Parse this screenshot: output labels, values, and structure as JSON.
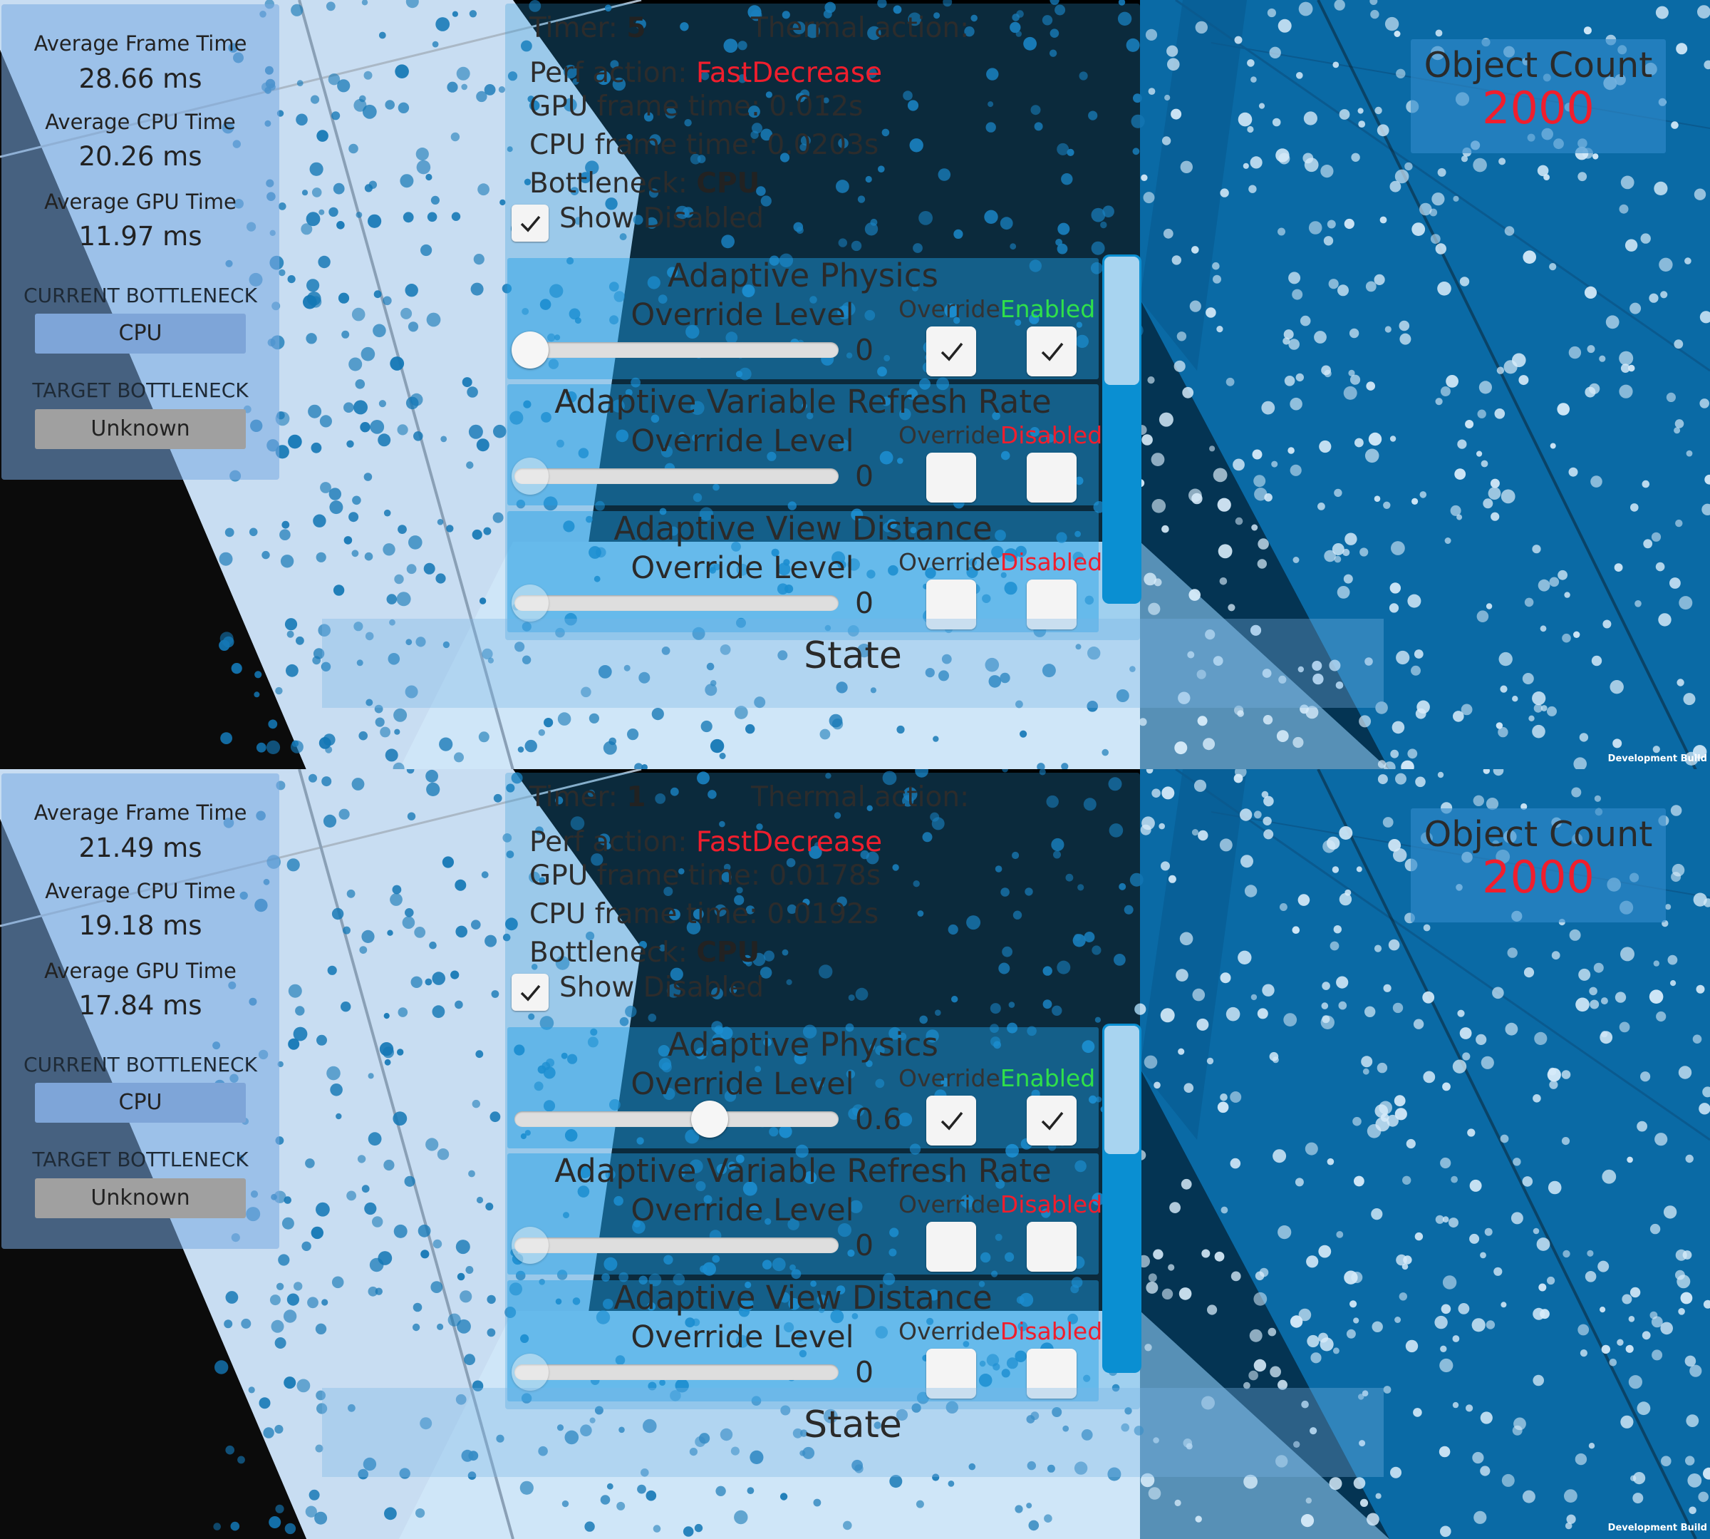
{
  "screens": [
    {
      "stats": {
        "avg_frame_label": "Average Frame Time",
        "avg_frame_value": "28.66 ms",
        "avg_cpu_label": "Average CPU Time",
        "avg_cpu_value": "20.26 ms",
        "avg_gpu_label": "Average GPU Time",
        "avg_gpu_value": "11.97 ms",
        "current_bottleneck_label": "CURRENT BOTTLENECK",
        "current_bottleneck_value": "CPU",
        "target_bottleneck_label": "TARGET BOTTLENECK",
        "target_bottleneck_value": "Unknown"
      },
      "object_count": {
        "title": "Object Count",
        "value": "2000"
      },
      "panel": {
        "timer_label": "Timer:",
        "timer_value": "5",
        "thermal_label": "Thermal action:",
        "perf_action_label": "Perf action:",
        "perf_action_value": "FastDecrease",
        "gpu_frame_time": "GPU frame time: 0.012s",
        "cpu_frame_time": "CPU frame time: 0.0203s",
        "bottleneck_label": "Bottleneck:",
        "bottleneck_value": "CPU",
        "show_disabled_label": "Show Disabled",
        "show_disabled_checked": true,
        "sections": [
          {
            "title": "Adaptive Physics",
            "override_level_label": "Override Level",
            "override_label": "Override",
            "status": "Enabled",
            "status_color": "#2fe04a",
            "level": 0,
            "level_text": "0",
            "override_checked": true,
            "enabled_checked": true,
            "slider_enabled": true
          },
          {
            "title": "Adaptive Variable Refresh Rate",
            "override_level_label": "Override Level",
            "override_label": "Override",
            "status": "Disabled",
            "status_color": "#f01e2d",
            "level": 0,
            "level_text": "0",
            "override_checked": false,
            "enabled_checked": false,
            "slider_enabled": false
          },
          {
            "title": "Adaptive View Distance",
            "override_level_label": "Override Level",
            "override_label": "Override",
            "status": "Disabled",
            "status_color": "#f01e2d",
            "level": 0,
            "level_text": "0",
            "override_checked": false,
            "enabled_checked": false,
            "slider_enabled": false
          }
        ]
      },
      "state_label": "State",
      "dev_build": "Development Build"
    },
    {
      "stats": {
        "avg_frame_label": "Average Frame Time",
        "avg_frame_value": "21.49 ms",
        "avg_cpu_label": "Average CPU Time",
        "avg_cpu_value": "19.18 ms",
        "avg_gpu_label": "Average GPU Time",
        "avg_gpu_value": "17.84 ms",
        "current_bottleneck_label": "CURRENT BOTTLENECK",
        "current_bottleneck_value": "CPU",
        "target_bottleneck_label": "TARGET BOTTLENECK",
        "target_bottleneck_value": "Unknown"
      },
      "object_count": {
        "title": "Object Count",
        "value": "2000"
      },
      "panel": {
        "timer_label": "Timer:",
        "timer_value": "1",
        "thermal_label": "Thermal action:",
        "perf_action_label": "Perf action:",
        "perf_action_value": "FastDecrease",
        "gpu_frame_time": "GPU frame time: 0.0178s",
        "cpu_frame_time": "CPU frame time: 0.0192s",
        "bottleneck_label": "Bottleneck:",
        "bottleneck_value": "CPU",
        "show_disabled_label": "Show Disabled",
        "show_disabled_checked": true,
        "sections": [
          {
            "title": "Adaptive Physics",
            "override_level_label": "Override Level",
            "override_label": "Override",
            "status": "Enabled",
            "status_color": "#2fe04a",
            "level": 0.6,
            "level_text": "0.6",
            "override_checked": true,
            "enabled_checked": true,
            "slider_enabled": true
          },
          {
            "title": "Adaptive Variable Refresh Rate",
            "override_level_label": "Override Level",
            "override_label": "Override",
            "status": "Disabled",
            "status_color": "#f01e2d",
            "level": 0,
            "level_text": "0",
            "override_checked": false,
            "enabled_checked": false,
            "slider_enabled": false
          },
          {
            "title": "Adaptive View Distance",
            "override_level_label": "Override Level",
            "override_label": "Override",
            "status": "Disabled",
            "status_color": "#f01e2d",
            "level": 0,
            "level_text": "0",
            "override_checked": false,
            "enabled_checked": false,
            "slider_enabled": false
          }
        ]
      },
      "state_label": "State",
      "dev_build": "Development Build"
    }
  ],
  "colors": {
    "sky_left": "#c8ddf2",
    "wall_right": "#0a6aa5",
    "wall_right_dark": "#07578a",
    "floor": "#cfe6f8",
    "dots": "#1477b5",
    "highlight_red": "#f01e2d",
    "highlight_green": "#2fe04a",
    "current_bottleneck_box": "#7ea5d8",
    "target_bottleneck_box": "#a0a0a0"
  }
}
